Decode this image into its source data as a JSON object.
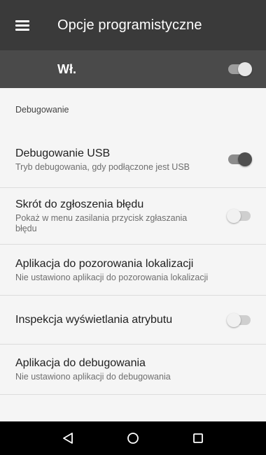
{
  "appbar": {
    "title": "Opcje programistyczne",
    "menu_icon": "hamburger-menu-icon"
  },
  "master": {
    "label": "Wł.",
    "enabled": true
  },
  "section": {
    "header": "Debugowanie"
  },
  "items": [
    {
      "title": "Debugowanie USB",
      "subtitle": "Tryb debugowania, gdy podłączone jest USB",
      "switch": "on"
    },
    {
      "title": "Skrót do zgłoszenia błędu",
      "subtitle": "Pokaż w menu zasilania przycisk zgłaszania błędu",
      "switch": "off"
    },
    {
      "title": "Aplikacja do pozorowania lokalizacji",
      "subtitle": "Nie ustawiono aplikacji do pozorowania lokalizacji"
    },
    {
      "title": "Inspekcja wyświetlania atrybutu",
      "switch": "off"
    },
    {
      "title": "Aplikacja do debugowania",
      "subtitle": "Nie ustawiono aplikacji do debugowania"
    }
  ],
  "navbar": {
    "back_icon": "back-triangle-icon",
    "home_icon": "home-circle-icon",
    "recents_icon": "recents-square-icon"
  },
  "colors": {
    "appbar": "#3a3a3a",
    "masterbar": "#4a4a4a",
    "background": "#f5f5f5",
    "navbar": "#000000"
  }
}
